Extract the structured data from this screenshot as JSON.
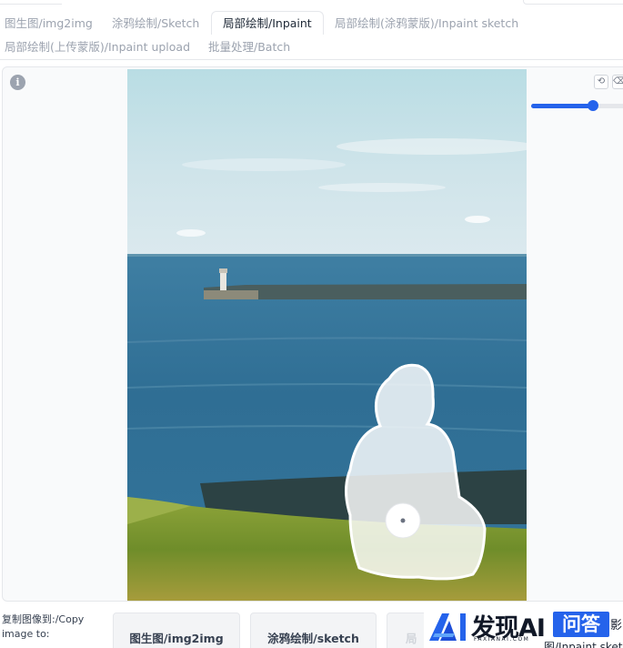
{
  "tabs": [
    {
      "label": "图生图/img2img",
      "active": false
    },
    {
      "label": "涂鸦绘制/Sketch",
      "active": false
    },
    {
      "label": "局部绘制/Inpaint",
      "active": true
    },
    {
      "label": "局部绘制(涂鸦蒙版)/Inpaint sketch",
      "active": false
    },
    {
      "label": "局部绘制(上传蒙版)/Inpaint upload",
      "active": false
    },
    {
      "label": "批量处理/Batch",
      "active": false
    }
  ],
  "canvas": {
    "info_icon_glyph": "i",
    "undo_glyph": "⟲",
    "eraser_glyph": "⌫",
    "brush_size_fraction": 0.62,
    "mask_color": "#ffffff"
  },
  "copy_to": {
    "label": "复制图像到:/Copy image to:",
    "buttons": [
      {
        "label": "图生图/img2img"
      },
      {
        "label": "涂鸦绘制/sketch"
      },
      {
        "label": "局"
      }
    ]
  },
  "watermark": {
    "title": "发现AI",
    "subtitle": "FAXIANAI.COM",
    "badge": "问答",
    "edge_char": "影"
  },
  "cut_off_text": "图/Inpaint sketch",
  "colors": {
    "accent": "#2563eb",
    "tab_inactive": "#9ca3af",
    "border": "#e5e7eb"
  }
}
